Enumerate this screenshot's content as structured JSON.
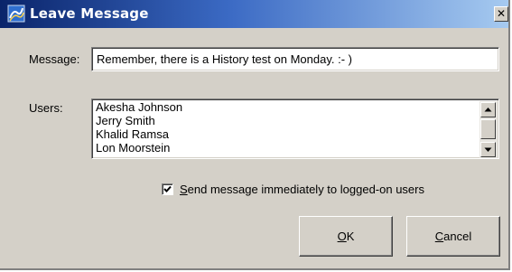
{
  "window": {
    "title": "Leave Message",
    "close_glyph": "✕",
    "title_icon": "wave-app-icon"
  },
  "message": {
    "label": "Message:",
    "value": "Remember, there is a History test on Monday. :- )"
  },
  "users": {
    "label": "Users:",
    "items": [
      "Akesha Johnson",
      "Jerry Smith",
      "Khalid Ramsa",
      "Lon Moorstein"
    ]
  },
  "send_immediately": {
    "checked": true,
    "mnemonic": "S",
    "label_rest": "end message immediately to logged-on users"
  },
  "buttons": {
    "ok_mnemonic": "O",
    "ok_rest": "K",
    "cancel_mnemonic": "C",
    "cancel_rest": "ancel"
  }
}
